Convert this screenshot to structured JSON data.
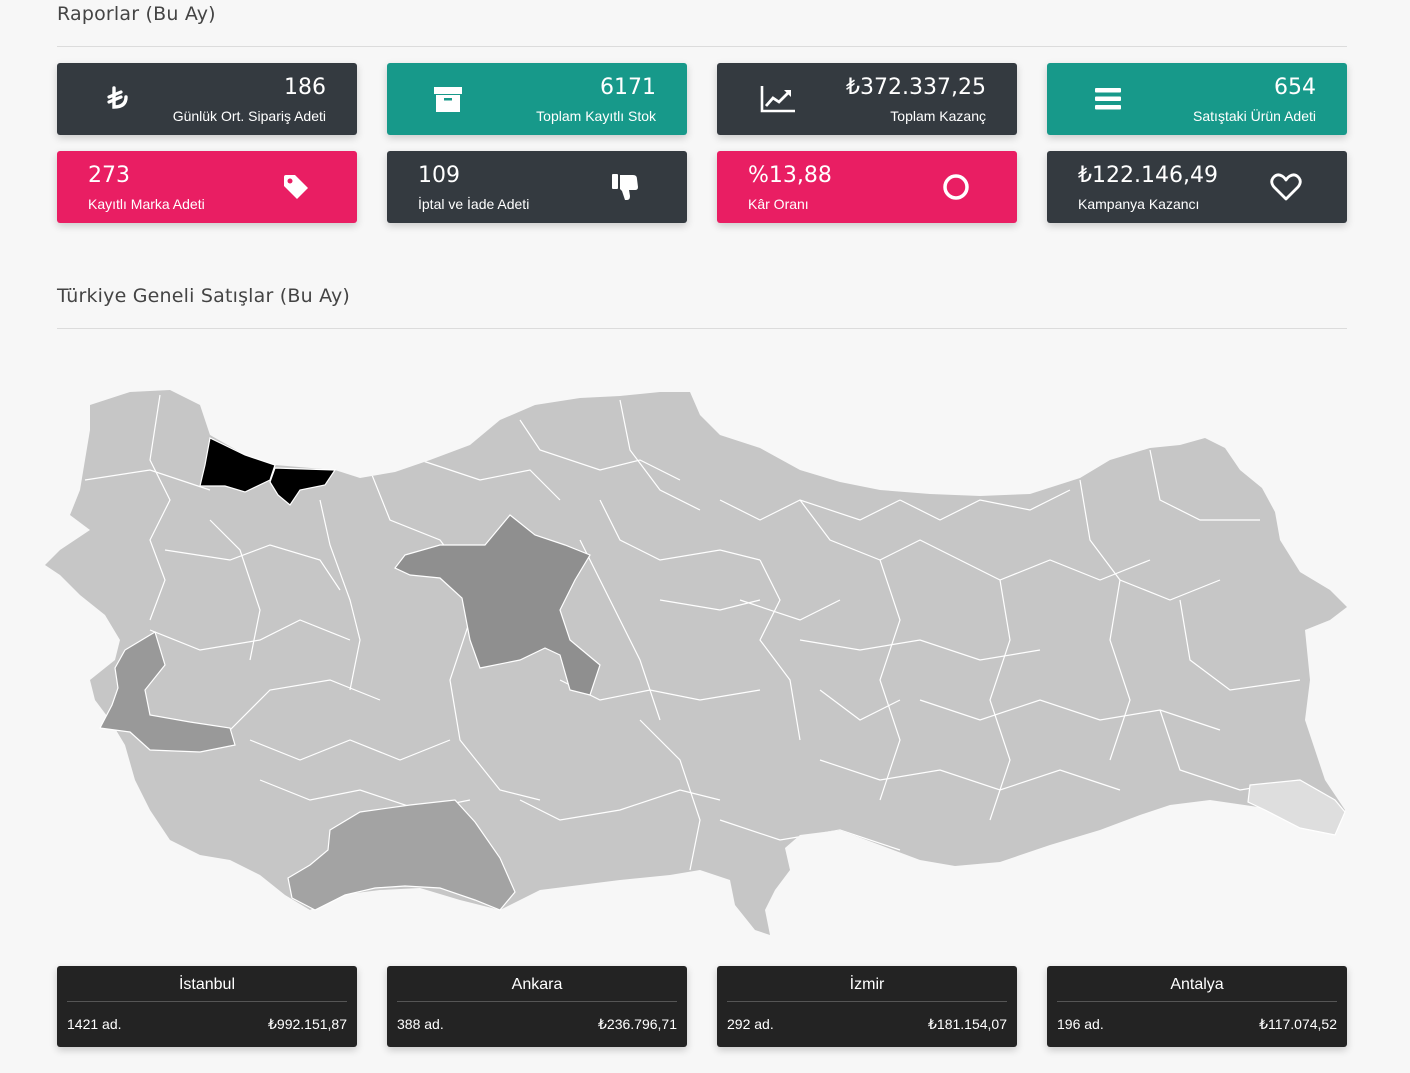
{
  "reports": {
    "title": "Raporlar (Bu Ay)",
    "cards": [
      {
        "value": "186",
        "label": "Günlük Ort. Sipariş Adeti",
        "icon": "lira-icon",
        "color": "#343a40"
      },
      {
        "value": "6171",
        "label": "Toplam Kayıtlı Stok",
        "icon": "archive-box-icon",
        "color": "#17998a"
      },
      {
        "value": "₺372.337,25",
        "label": "Toplam Kazanç",
        "icon": "line-chart-icon",
        "color": "#343a40"
      },
      {
        "value": "654",
        "label": "Satıştaki Ürün Adeti",
        "icon": "bars-icon",
        "color": "#17998a"
      },
      {
        "value": "273",
        "label": "Kayıtlı Marka Adeti",
        "icon": "tag-icon",
        "color": "#e91e63"
      },
      {
        "value": "109",
        "label": "İptal ve İade Adeti",
        "icon": "thumbs-down-icon",
        "color": "#343a40"
      },
      {
        "value": "%13,88",
        "label": "Kâr Oranı",
        "icon": "circle-icon",
        "color": "#e91e63"
      },
      {
        "value": "₺122.146,49",
        "label": "Kampanya Kazancı",
        "icon": "heart-icon",
        "color": "#343a40"
      }
    ]
  },
  "sales_map": {
    "title": "Türkiye Geneli Satışlar (Bu Ay)",
    "colors": {
      "base": "#c6c6c6",
      "istanbul": "#000000",
      "ankara": "#8f8f8f",
      "izmir": "#999999",
      "antalya": "#a3a3a3",
      "light": "#dedede",
      "border": "#ffffff"
    }
  },
  "top_cities": [
    {
      "name": "İstanbul",
      "count": "1421 ad.",
      "total": "₺992.151,87"
    },
    {
      "name": "Ankara",
      "count": "388 ad.",
      "total": "₺236.796,71"
    },
    {
      "name": "İzmir",
      "count": "292 ad.",
      "total": "₺181.154,07"
    },
    {
      "name": "Antalya",
      "count": "196 ad.",
      "total": "₺117.074,52"
    }
  ]
}
